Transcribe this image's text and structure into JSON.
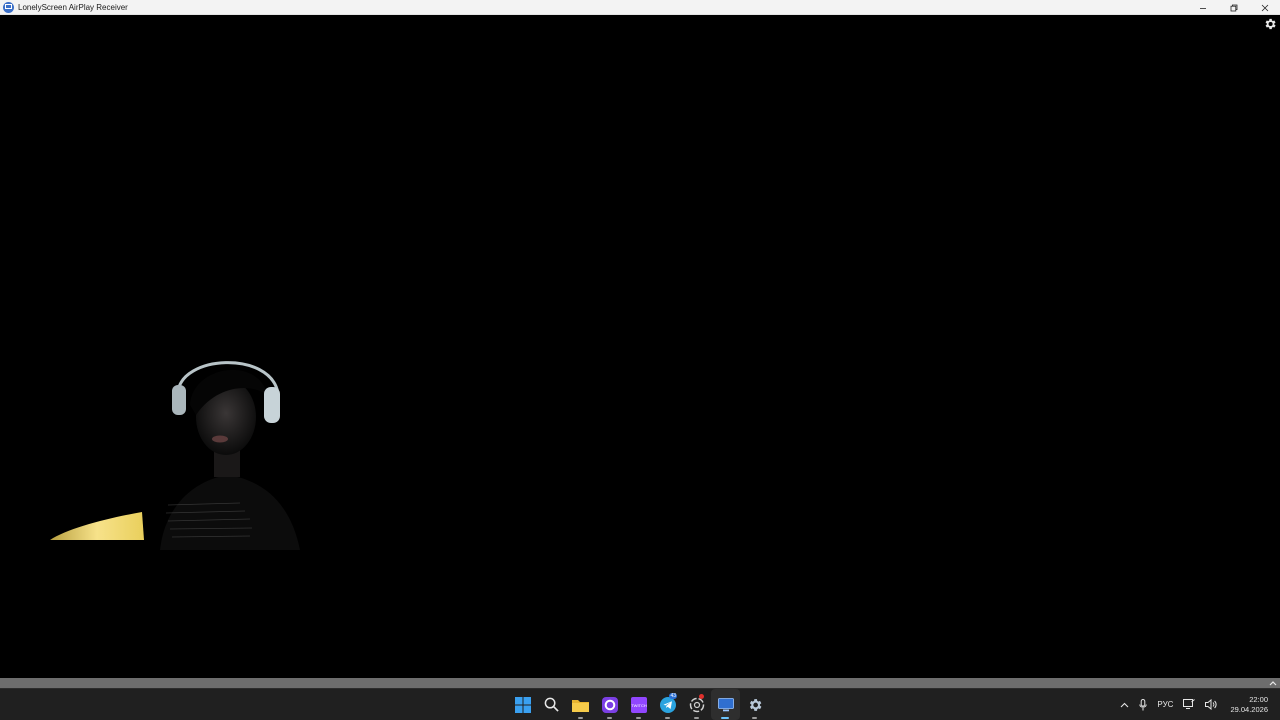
{
  "window": {
    "title": "LonelyScreen AirPlay Receiver",
    "controls": [
      "minimize",
      "restore",
      "close"
    ]
  },
  "stream": {
    "settings_icon": "gear-icon"
  },
  "taskbar": {
    "apps": [
      {
        "name": "start",
        "icon": "windows-logo-icon",
        "running": false
      },
      {
        "name": "search",
        "icon": "search-icon",
        "running": false
      },
      {
        "name": "file-explorer",
        "icon": "folder-icon",
        "running": true
      },
      {
        "name": "app-purple-circle",
        "icon": "purple-circle-app-icon",
        "running": true
      },
      {
        "name": "twitch",
        "icon": "twitch-icon",
        "label": "TWITCH",
        "running": true
      },
      {
        "name": "telegram",
        "icon": "telegram-icon",
        "badge": "43",
        "running": true
      },
      {
        "name": "app-swirl",
        "icon": "swirl-app-icon",
        "running": true
      },
      {
        "name": "lonelyscreen",
        "icon": "monitor-icon",
        "running": true,
        "active": true
      },
      {
        "name": "settings",
        "icon": "gear-icon",
        "running": true
      }
    ],
    "tray": {
      "overflow_icon": "chevron-up-icon",
      "mic_icon": "microphone-icon",
      "language": "РУС",
      "network_icon": "network-icon",
      "volume_icon": "volume-icon",
      "time": "22:00",
      "date": "29.04.2026"
    }
  },
  "colors": {
    "titlebar": "#f3f3f3",
    "taskbar": "#202020",
    "accent": "#6cc4ff"
  }
}
